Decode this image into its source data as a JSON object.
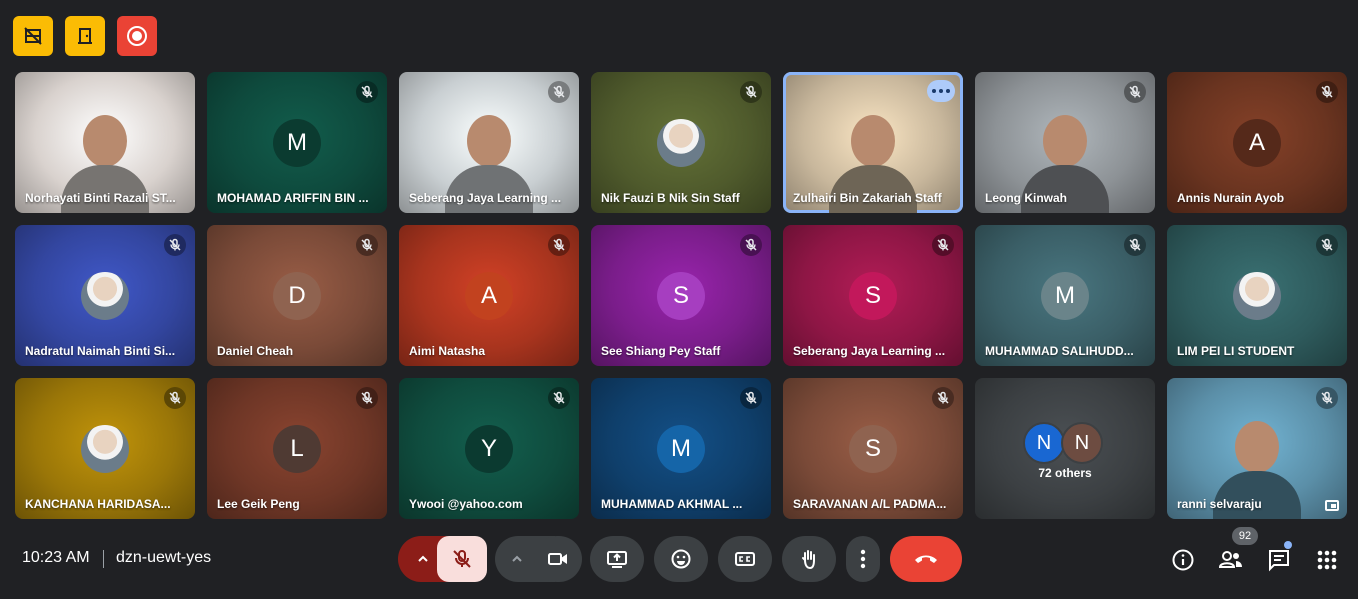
{
  "top_buttons": [
    {
      "name": "hide-tiles-button",
      "icon": "hide-tiles-icon",
      "color": "#fbbc04"
    },
    {
      "name": "host-controls-button",
      "icon": "door-icon",
      "color": "#fbbc04"
    },
    {
      "name": "recording-button",
      "icon": "record-icon",
      "color": "#ea4335"
    }
  ],
  "participants": [
    {
      "name": "Norhayati Binti Razali ST...",
      "type": "photo",
      "bg": "#d9d2ce",
      "mic": "none"
    },
    {
      "name": "MOHAMAD ARIFFIN BIN ...",
      "type": "letter",
      "letter": "M",
      "bg": "#0e4a3d",
      "av": "#0b3b30",
      "mic": "muted"
    },
    {
      "name": "Seberang Jaya Learning ...",
      "type": "photo",
      "bg": "#c9cfd2",
      "mic": "muted"
    },
    {
      "name": "Nik Fauzi B Nik Sin Staff",
      "type": "photo-avatar",
      "bg": "#4f5a2c",
      "mic": "muted"
    },
    {
      "name": "Zulhairi Bin Zakariah Staff",
      "type": "photo",
      "bg": "#c8b79c",
      "mic": "more",
      "active": true
    },
    {
      "name": "Leong Kinwah",
      "type": "photo",
      "bg": "#8d9296",
      "mic": "muted"
    },
    {
      "name": "Annis Nurain Ayob",
      "type": "letter",
      "letter": "A",
      "bg": "#6a3420",
      "av": "#55291a",
      "mic": "muted"
    },
    {
      "name": "Nadratul Naimah Binti Si...",
      "type": "photo-avatar",
      "bg": "#3346a0",
      "mic": "muted"
    },
    {
      "name": "Daniel Cheah",
      "type": "letter",
      "letter": "D",
      "bg": "#7a4a38",
      "av": "#8f6350",
      "mic": "muted"
    },
    {
      "name": "Aimi Natasha",
      "type": "letter",
      "letter": "A",
      "bg": "#a8341e",
      "av": "#c2421f",
      "mic": "muted"
    },
    {
      "name": "See Shiang Pey Staff",
      "type": "letter",
      "letter": "S",
      "bg": "#7a1d8a",
      "av": "#a63ec0",
      "mic": "muted"
    },
    {
      "name": "Seberang Jaya Learning ...",
      "type": "letter",
      "letter": "S",
      "bg": "#8e1645",
      "av": "#c2185b",
      "mic": "muted"
    },
    {
      "name": "MUHAMMAD SALIHUDD...",
      "type": "letter",
      "letter": "M",
      "bg": "#3a5e66",
      "av": "#6a848a",
      "mic": "muted"
    },
    {
      "name": "LIM PEI LI STUDENT",
      "type": "photo-avatar",
      "bg": "#2e5a5c",
      "mic": "muted"
    },
    {
      "name": "KANCHANA HARIDASA...",
      "type": "photo-avatar",
      "bg": "#9a7608",
      "mic": "muted"
    },
    {
      "name": "Lee Geik Peng",
      "type": "letter",
      "letter": "L",
      "bg": "#6e3626",
      "av": "#4f3a33",
      "mic": "muted"
    },
    {
      "name": "Ywooi @yahoo.com",
      "type": "letter",
      "letter": "Y",
      "bg": "#0f4c3e",
      "av": "#0b3a30",
      "mic": "muted"
    },
    {
      "name": "MUHAMMAD AKHMAL ...",
      "type": "letter",
      "letter": "M",
      "bg": "#0f3f6b",
      "av": "#1565a8",
      "mic": "muted"
    },
    {
      "name": "SARAVANAN A/L PADMA...",
      "type": "letter",
      "letter": "S",
      "bg": "#7a4a38",
      "av": "#8f6350",
      "mic": "muted"
    },
    {
      "name": "72 others",
      "type": "others",
      "bg": "#3c4043",
      "mic": "none"
    },
    {
      "name": "ranni selvaraju",
      "type": "photo",
      "bg": "#5b8fa8",
      "mic": "muted"
    }
  ],
  "others": {
    "label": "72 others",
    "letters": [
      "N",
      "N"
    ],
    "colors": [
      "#1967d2",
      "#6d4c41"
    ]
  },
  "footer": {
    "time": "10:23 AM",
    "meeting_code": "dzn-uewt-yes",
    "participant_count": "92"
  },
  "colors": {
    "background": "#202124",
    "control_bg": "#3c4043",
    "end_call": "#ea4335",
    "mic_off_bg": "#f9dedc",
    "mic_chevron_bg": "#8c1d18",
    "accent": "#8ab4f8"
  }
}
